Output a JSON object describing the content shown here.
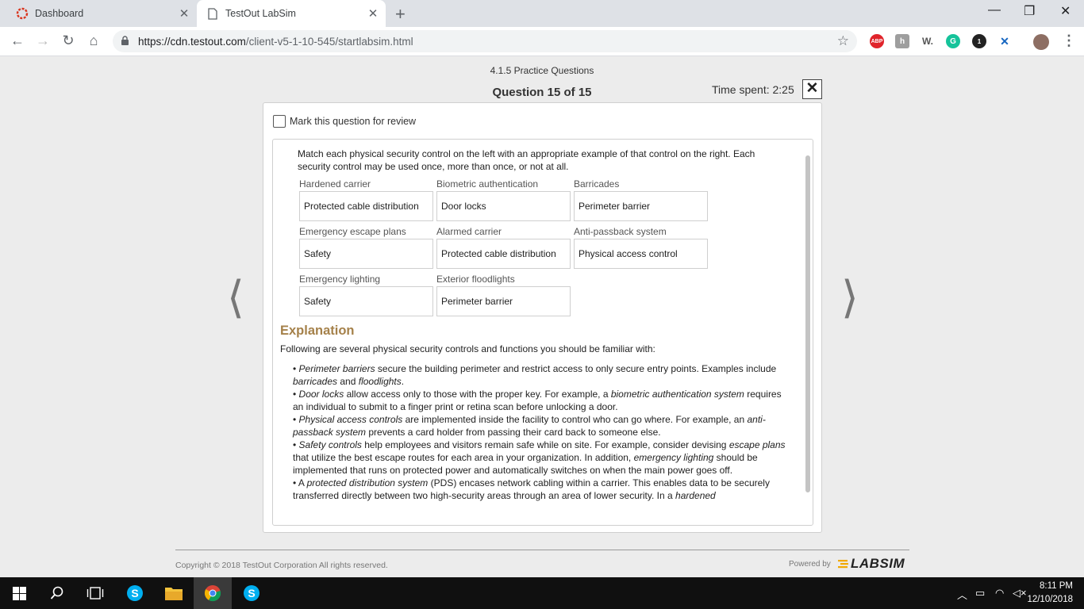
{
  "browser": {
    "tabs": [
      {
        "label": "Dashboard",
        "active": false
      },
      {
        "label": "TestOut LabSim",
        "active": true
      }
    ],
    "url_prefix": "https://cdn.testout.com",
    "url_path": "/client-v5-1-10-545/startlabsim.html",
    "extensions": [
      "ABP",
      "W.",
      "1"
    ]
  },
  "header": {
    "breadcrumb": "4.1.5 Practice Questions",
    "question_number": "Question 15 of 15",
    "time_spent": "Time spent: 2:25"
  },
  "review_label": "Mark this question for review",
  "prompt": "Match each physical security control on the left with an appropriate example of that control on the right. Each security control may be used once, more than once, or not at all.",
  "matches": [
    {
      "label": "Hardened carrier",
      "answer": "Protected cable distribution"
    },
    {
      "label": "Biometric authentication",
      "answer": "Door locks"
    },
    {
      "label": "Barricades",
      "answer": "Perimeter barrier"
    },
    {
      "label": "Emergency escape plans",
      "answer": "Safety"
    },
    {
      "label": "Alarmed carrier",
      "answer": "Protected cable distribution"
    },
    {
      "label": "Anti-passback system",
      "answer": "Physical access control"
    },
    {
      "label": "Emergency lighting",
      "answer": "Safety"
    },
    {
      "label": "Exterior floodlights",
      "answer": "Perimeter barrier"
    }
  ],
  "explanation": {
    "title": "Explanation",
    "intro": "Following are several physical security controls and functions you should be familiar with:",
    "b1": {
      "a": "• ",
      "i1": "Perimeter barriers",
      "t1": " secure the building perimeter and restrict access to only secure entry points. Examples include ",
      "i2": "barricades",
      "t2": " and ",
      "i3": "floodlights",
      "t3": "."
    },
    "b2": {
      "a": "• ",
      "i1": "Door locks",
      "t1": " allow access only to those with the proper key. For example, a ",
      "i2": "biometric authentication system",
      "t2": " requires an individual to submit to a finger print or retina scan before unlocking a door."
    },
    "b3": {
      "a": "• ",
      "i1": "Physical access controls",
      "t1": " are implemented inside the facility to control who can go where. For example, an ",
      "i2": "anti-passback system",
      "t2": " prevents a card holder from passing their card back to someone else."
    },
    "b4": {
      "a": "• ",
      "i1": "Safety controls",
      "t1": " help employees and visitors remain safe while on site. For example, consider devising ",
      "i2": "escape plans",
      "t2": " that utilize the best escape routes for each area in your organization. In addition, ",
      "i3": "emergency lighting",
      "t3": " should be implemented that runs on protected power and automatically switches on when the main power goes off."
    },
    "b5": {
      "a": "• A ",
      "i1": "protected distribution system",
      "t1": " (PDS) encases network cabling within a carrier. This enables data to be securely transferred directly between two high-security areas through an area of lower security. In a ",
      "i2": "hardened"
    }
  },
  "footer": {
    "copyright": "Copyright © 2018  TestOut Corporation All rights reserved.",
    "powered_by": "Powered by",
    "logo_text": "LABSIM"
  },
  "taskbar": {
    "time": "8:11 PM",
    "date": "12/10/2018"
  },
  "colors": {
    "explanation_title": "#a5814a",
    "taskbar": "#101010"
  }
}
